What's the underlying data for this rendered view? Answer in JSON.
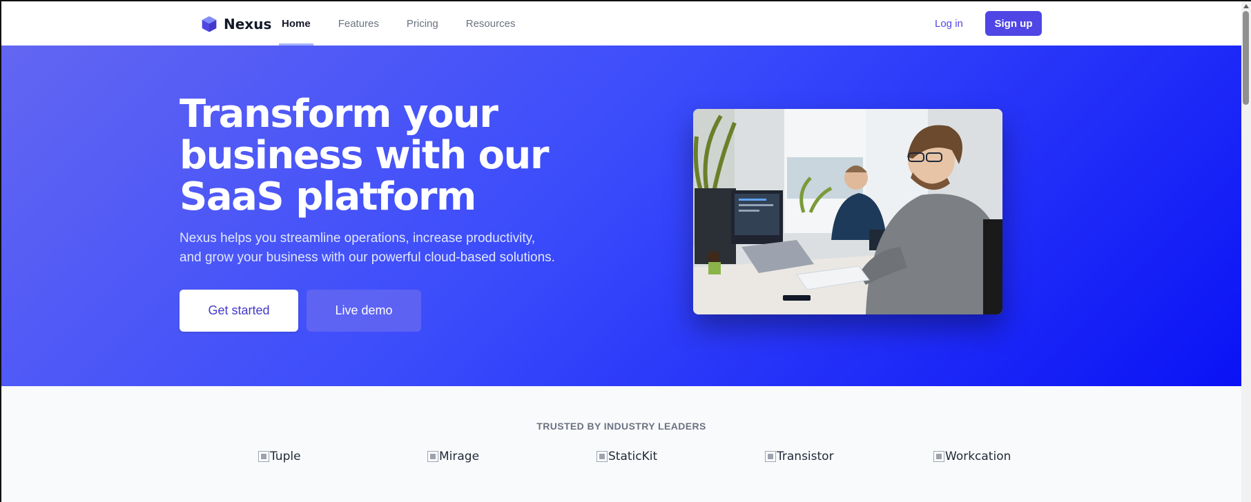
{
  "brand": {
    "name": "Nexus",
    "accent": "#4f46e5"
  },
  "nav": {
    "links": [
      {
        "label": "Home",
        "active": true
      },
      {
        "label": "Features",
        "active": false
      },
      {
        "label": "Pricing",
        "active": false
      },
      {
        "label": "Resources",
        "active": false
      }
    ],
    "login_label": "Log in",
    "signup_label": "Sign up"
  },
  "hero": {
    "title": "Transform your business with our SaaS platform",
    "subtitle_line1": "Nexus helps you streamline operations, increase productivity,",
    "subtitle_line2": "and grow your business with our powerful cloud-based solutions.",
    "primary_cta": "Get started",
    "secondary_cta": "Live demo",
    "image": "office-workers-at-desks-photo"
  },
  "trusted": {
    "title": "TRUSTED BY INDUSTRY LEADERS",
    "logos": [
      "Tuple",
      "Mirage",
      "StaticKit",
      "Transistor",
      "Workcation"
    ]
  }
}
